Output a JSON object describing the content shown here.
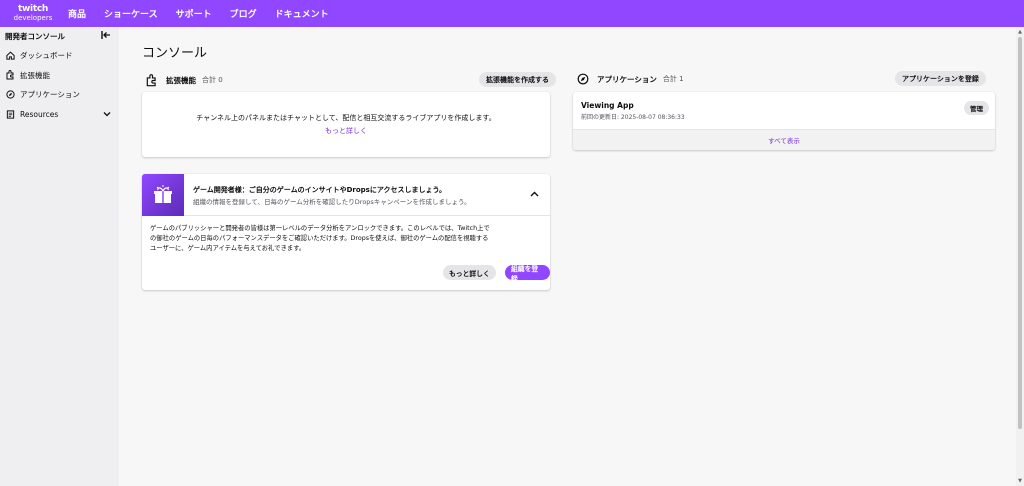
{
  "topnav": {
    "logo_line1": "twitch",
    "logo_line2": "developers",
    "links": [
      "商品",
      "ショーケース",
      "サポート",
      "ブログ",
      "ドキュメント"
    ],
    "bg_color": "#9147ff"
  },
  "sidebar": {
    "title": "開発者コンソール",
    "collapse_icon": "collapse-left-icon",
    "items": [
      {
        "label": "ダッシュボード",
        "icon": "home-icon"
      },
      {
        "label": "拡張機能",
        "icon": "puzzle-icon"
      },
      {
        "label": "アプリケーション",
        "icon": "compass-icon"
      },
      {
        "label": "Resources",
        "icon": "document-icon",
        "expandable": true
      }
    ]
  },
  "main": {
    "title": "コンソール",
    "extensions": {
      "label": "拡張機能",
      "count": "合計 0",
      "create_button": "拡張機能を作成する",
      "description": "チャンネル上のパネルまたはチャットとして、配信と相互交流するライブアプリを作成します。",
      "learn_more": "もっと詳しく"
    },
    "applications": {
      "label": "アプリケーション",
      "count": "合計 1",
      "register_button": "アプリケーションを登録",
      "items": [
        {
          "name": "Viewing App",
          "updated": "前回の更新日: 2025-08-07 08:36:33",
          "manage": "管理"
        }
      ],
      "show_all": "すべて表示"
    },
    "game_dev": {
      "title": "ゲーム開発者様：ご自分のゲームのインサイトやDropsにアクセスしましょう。",
      "subtitle": "組織の情報を登録して、日毎のゲーム分析を確認したりDropsキャンペーンを作成しましょう。",
      "body_lines": [
        "ゲームのパブリッシャーと開発者の皆様は第一レベルのデータ分析をアンロックできます。このレベルでは、Twitch上で",
        "の御社のゲームの日毎のパフォーマンスデータをご確認いただけます。Dropsを使えば、御社のゲームの配信を視聴する",
        "ユーザーに、ゲーム内アイテムを与えてお礼できます。"
      ],
      "learn_more_button": "もっと詳しく",
      "register_org_button": "組織を登録"
    }
  },
  "colors": {
    "accent": "#9147ff",
    "link": "#772ce8"
  }
}
